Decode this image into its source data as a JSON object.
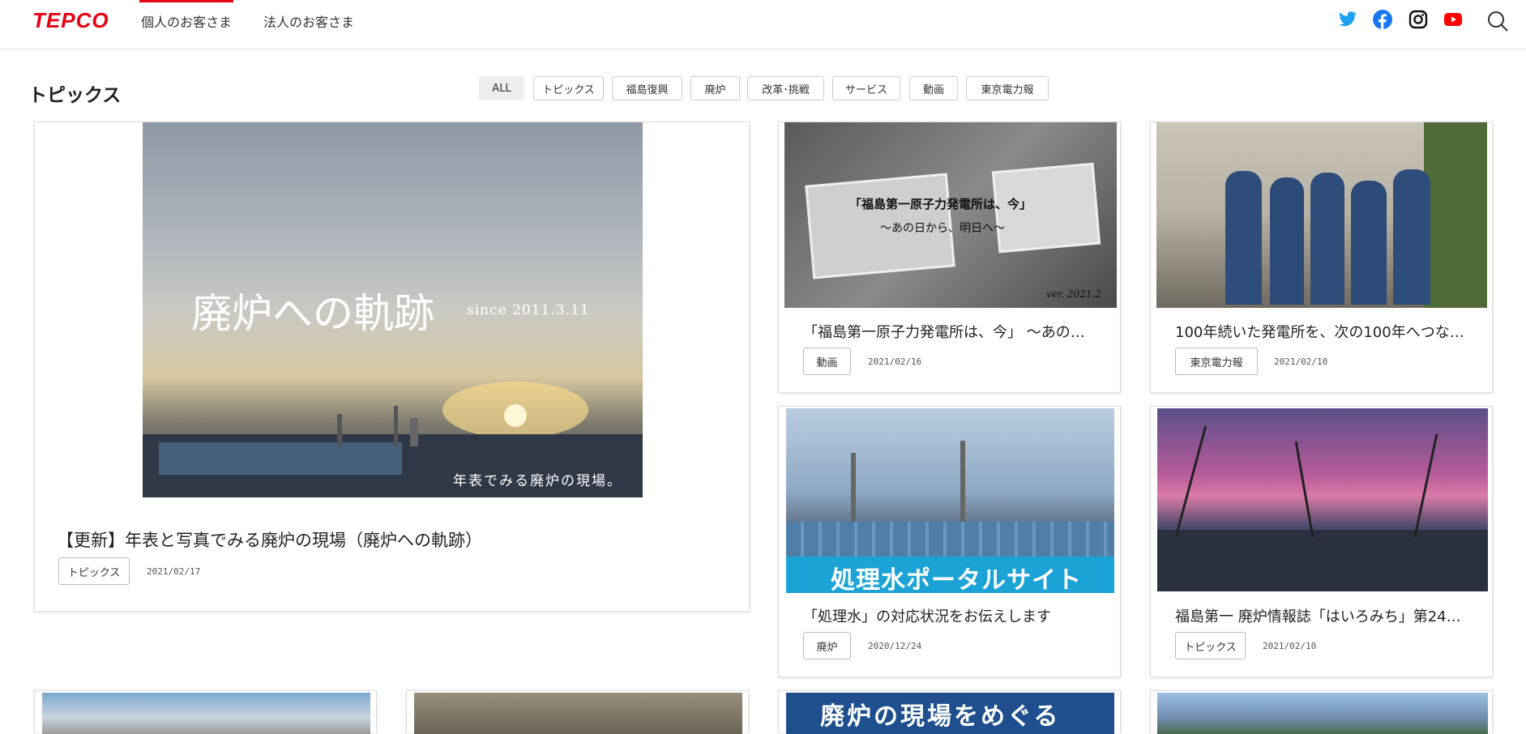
{
  "header": {
    "logo": "TEPCO",
    "nav": [
      {
        "label": "個人のお客さま"
      },
      {
        "label": "法人のお客さま"
      }
    ],
    "social_icons": [
      "twitter-icon",
      "facebook-icon",
      "instagram-icon",
      "youtube-icon"
    ],
    "search_icon": "search-icon",
    "accent_color": "#e60012"
  },
  "topics": {
    "title": "トピックス",
    "filters": [
      "ALL",
      "トピックス",
      "福島復興",
      "廃炉",
      "改革･挑戦",
      "サービス",
      "動画",
      "東京電力報"
    ],
    "active_filter": "ALL"
  },
  "cards": [
    {
      "title": "【更新】年表と写真でみる廃炉の現場（廃炉への軌跡）",
      "tag": "トピックス",
      "date": "2021/02/17",
      "image_text": {
        "main": "廃炉への軌跡",
        "since": "since 2011.3.11",
        "caption": "年表でみる廃炉の現場。"
      }
    },
    {
      "title": "「福島第一原子力発電所は、今」 ～あの…",
      "tag": "動画",
      "date": "2021/02/16",
      "image_text": {
        "line1": "「福島第一原子力発電所は、今」",
        "line2": "～あの日から、明日へ～",
        "version": "ver. 2021.2"
      }
    },
    {
      "title": "100年続いた発電所を、次の100年へつな…",
      "tag": "東京電力報",
      "date": "2021/02/10"
    },
    {
      "title": "「処理水」の対応状況をお伝えします",
      "tag": "廃炉",
      "date": "2020/12/24",
      "image_text": {
        "banner": "処理水ポータルサイト"
      }
    },
    {
      "title": "福島第一 廃炉情報誌「はいろみち」第24…",
      "tag": "トピックス",
      "date": "2021/02/10"
    }
  ],
  "bottom_cards": {
    "image_text": {
      "banner": "廃炉の現場をめぐる"
    }
  }
}
